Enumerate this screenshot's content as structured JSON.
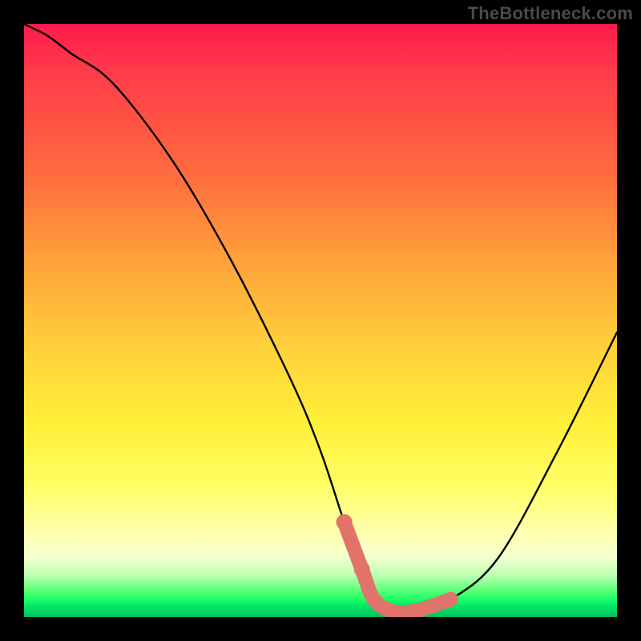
{
  "watermark": "TheBottleneck.com",
  "chart_data": {
    "type": "line",
    "title": "",
    "xlabel": "",
    "ylabel": "",
    "xlim": [
      0,
      100
    ],
    "ylim": [
      0,
      100
    ],
    "series": [
      {
        "name": "bottleneck-curve",
        "x": [
          0,
          4,
          8,
          15,
          25,
          35,
          45,
          50,
          54,
          57,
          59,
          62,
          66,
          72,
          80,
          90,
          100
        ],
        "values": [
          100,
          98,
          95,
          90,
          77,
          60,
          40,
          28,
          16,
          8,
          3,
          1,
          1,
          3,
          10,
          28,
          48
        ]
      }
    ],
    "highlight_segment": {
      "x_start": 54,
      "x_end": 72
    },
    "colors": {
      "curve": "#000000",
      "highlight": "#e2736b",
      "background_top": "#ff1a4d",
      "background_mid": "#ffd23a",
      "background_bottom": "#00e066",
      "frame": "#000000",
      "watermark": "#4a4a4a"
    }
  }
}
